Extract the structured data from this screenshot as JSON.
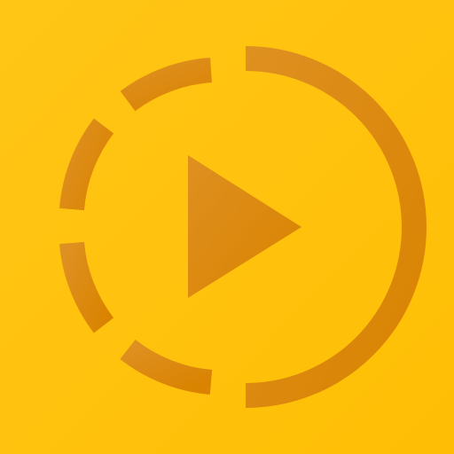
{
  "app_icon": {
    "icon": "play-circle-dashed-icon",
    "colors": {
      "background_top": "#FFC616",
      "background_bottom": "#FFBE05",
      "symbol_light": "#DE9020",
      "symbol_dark": "#D98300"
    }
  }
}
